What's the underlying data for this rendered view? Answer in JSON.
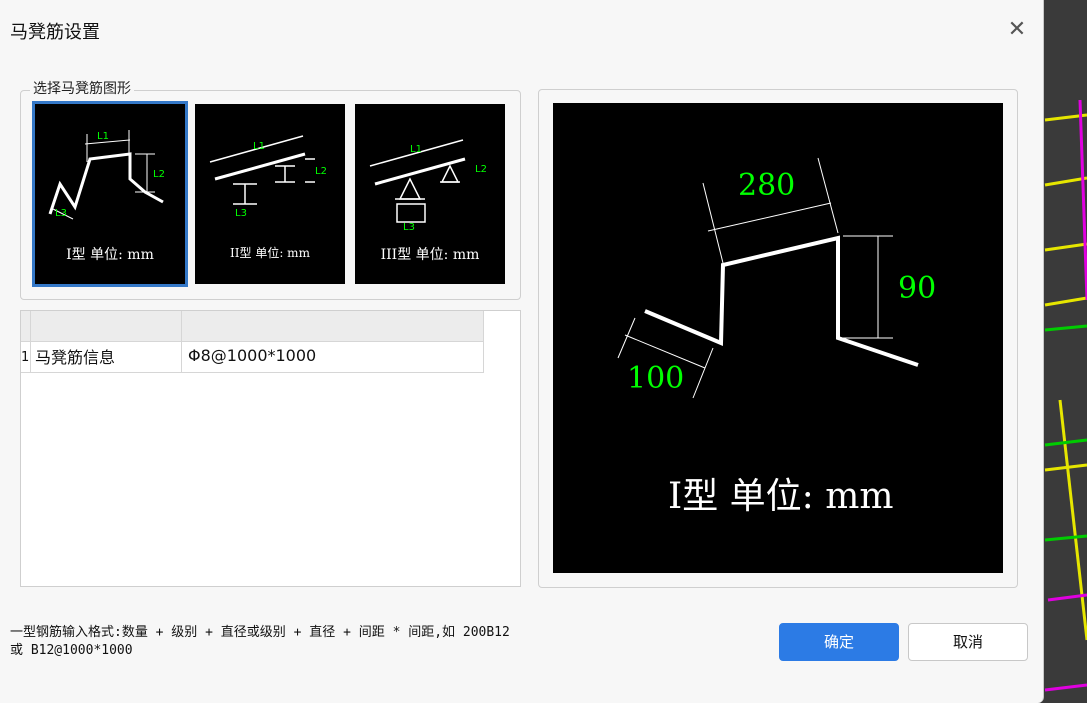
{
  "window": {
    "title": "马凳筋设置",
    "close_icon": "close-icon"
  },
  "shape_group": {
    "label": "选择马凳筋图形",
    "thumbnails": [
      {
        "caption": "I型 单位: mm",
        "labels": [
          "L1",
          "L2",
          "L3"
        ]
      },
      {
        "caption": "II型 单位: mm",
        "labels": [
          "L1",
          "L2",
          "L3"
        ]
      },
      {
        "caption": "III型 单位: mm",
        "labels": [
          "L1",
          "L2",
          "L3"
        ]
      }
    ]
  },
  "table": {
    "rows": [
      {
        "index": "1",
        "name": "马凳筋信息",
        "value": "Φ8@1000*1000"
      }
    ]
  },
  "preview": {
    "dim_top": "280",
    "dim_right": "90",
    "dim_left": "100",
    "caption": "I型 单位: mm"
  },
  "hint": {
    "line1": "一型钢筋输入格式:数量 + 级别 + 直径或级别 + 直径 + 间距 * 间距,如 200B12",
    "line2": "或 B12@1000*1000"
  },
  "buttons": {
    "ok": "确定",
    "cancel": "取消"
  },
  "colors": {
    "accent": "#2c7be5",
    "dim_label": "#00ff00"
  }
}
